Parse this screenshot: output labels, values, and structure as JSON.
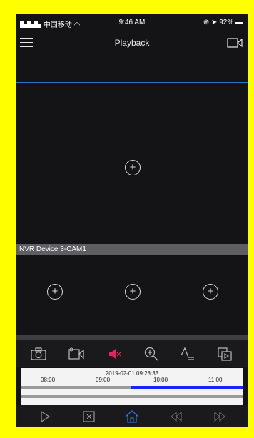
{
  "status_bar": {
    "carrier": "▙▙▙ 中国移动 ◠",
    "time": "9:46 AM",
    "battery": "⊕ ➤ 92% ▬"
  },
  "nav": {
    "title": "Playback",
    "menu_icon": "hamburger-menu-icon",
    "right_icon": "video-camera-icon"
  },
  "main_view": {
    "add_icon": "plus-circle-icon",
    "camera_label": "NVR Device 3-CAM1"
  },
  "tiles": [
    {
      "add_icon": "plus-circle-icon"
    },
    {
      "add_icon": "plus-circle-icon"
    },
    {
      "add_icon": "plus-circle-icon"
    }
  ],
  "controls": [
    {
      "icon": "camera-icon"
    },
    {
      "icon": "record-video-icon"
    },
    {
      "icon": "speaker-muted-icon",
      "color": "#e0245e"
    },
    {
      "icon": "zoom-in-icon"
    },
    {
      "icon": "fisheye-icon"
    },
    {
      "icon": "clip-icon"
    }
  ],
  "timeline": {
    "date": "2019-02-01 09:28:33",
    "ticks": [
      "08:00",
      "09:00",
      "10:00",
      "11:00"
    ],
    "recording_color": "#1a23ff"
  },
  "bottom_bar": [
    {
      "icon": "play-icon"
    },
    {
      "icon": "stop-icon"
    },
    {
      "icon": "home-icon",
      "color": "#2f6fd8"
    },
    {
      "icon": "rewind-icon"
    },
    {
      "icon": "fast-forward-icon"
    }
  ],
  "colors": {
    "frame": "#ffff00",
    "background": "#141416",
    "accent": "#2b78c4"
  }
}
